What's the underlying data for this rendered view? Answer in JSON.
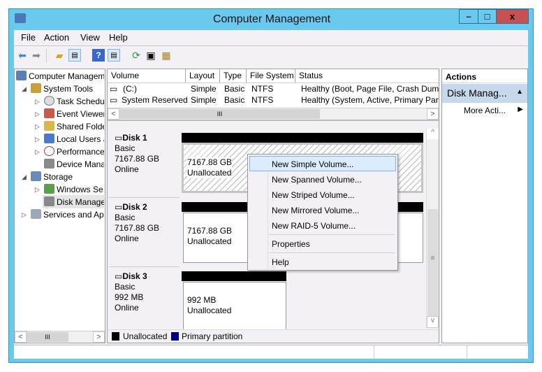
{
  "window": {
    "title": "Computer Management"
  },
  "menu": [
    "File",
    "Action",
    "View",
    "Help"
  ],
  "tree": {
    "items": [
      {
        "label": "Computer Managemen"
      },
      {
        "label": "System Tools"
      },
      {
        "label": "Task Scheduler"
      },
      {
        "label": "Event Viewer"
      },
      {
        "label": "Shared Folders"
      },
      {
        "label": "Local Users a"
      },
      {
        "label": "Performance"
      },
      {
        "label": "Device Manager"
      },
      {
        "label": "Storage"
      },
      {
        "label": "Windows Se"
      },
      {
        "label": "Disk Management"
      },
      {
        "label": "Services and Ap"
      }
    ]
  },
  "volumes": {
    "columns": [
      "Volume",
      "Layout",
      "Type",
      "File System",
      "Status"
    ],
    "rows": [
      {
        "volume": "(C:)",
        "layout": "Simple",
        "type": "Basic",
        "fs": "NTFS",
        "status": "Healthy (Boot, Page File, Crash Dump"
      },
      {
        "volume": "System Reserved",
        "layout": "Simple",
        "type": "Basic",
        "fs": "NTFS",
        "status": "Healthy (System, Active, Primary Part"
      }
    ]
  },
  "disks": [
    {
      "name": "Disk 1",
      "type": "Basic",
      "size": "7167.88 GB",
      "state": "Online",
      "part_size": "7167.88 GB",
      "part_status": "Unallocated"
    },
    {
      "name": "Disk 2",
      "type": "Basic",
      "size": "7167.88 GB",
      "state": "Online",
      "part_size": "7167.88 GB",
      "part_status": "Unallocated"
    },
    {
      "name": "Disk 3",
      "type": "Basic",
      "size": "992 MB",
      "state": "Online",
      "part_size": "992 MB",
      "part_status": "Unallocated"
    }
  ],
  "legend": [
    {
      "label": "Unallocated",
      "color": "#000000"
    },
    {
      "label": "Primary partition",
      "color": "#000080"
    }
  ],
  "actions": {
    "header": "Actions",
    "section": "Disk Manag...",
    "more": "More Acti..."
  },
  "context_menu": {
    "items": [
      "New Simple Volume...",
      "New Spanned Volume...",
      "New Striped Volume...",
      "New Mirrored Volume...",
      "New RAID-5 Volume...",
      "Properties",
      "Help"
    ]
  },
  "scroll_glyph": "III"
}
